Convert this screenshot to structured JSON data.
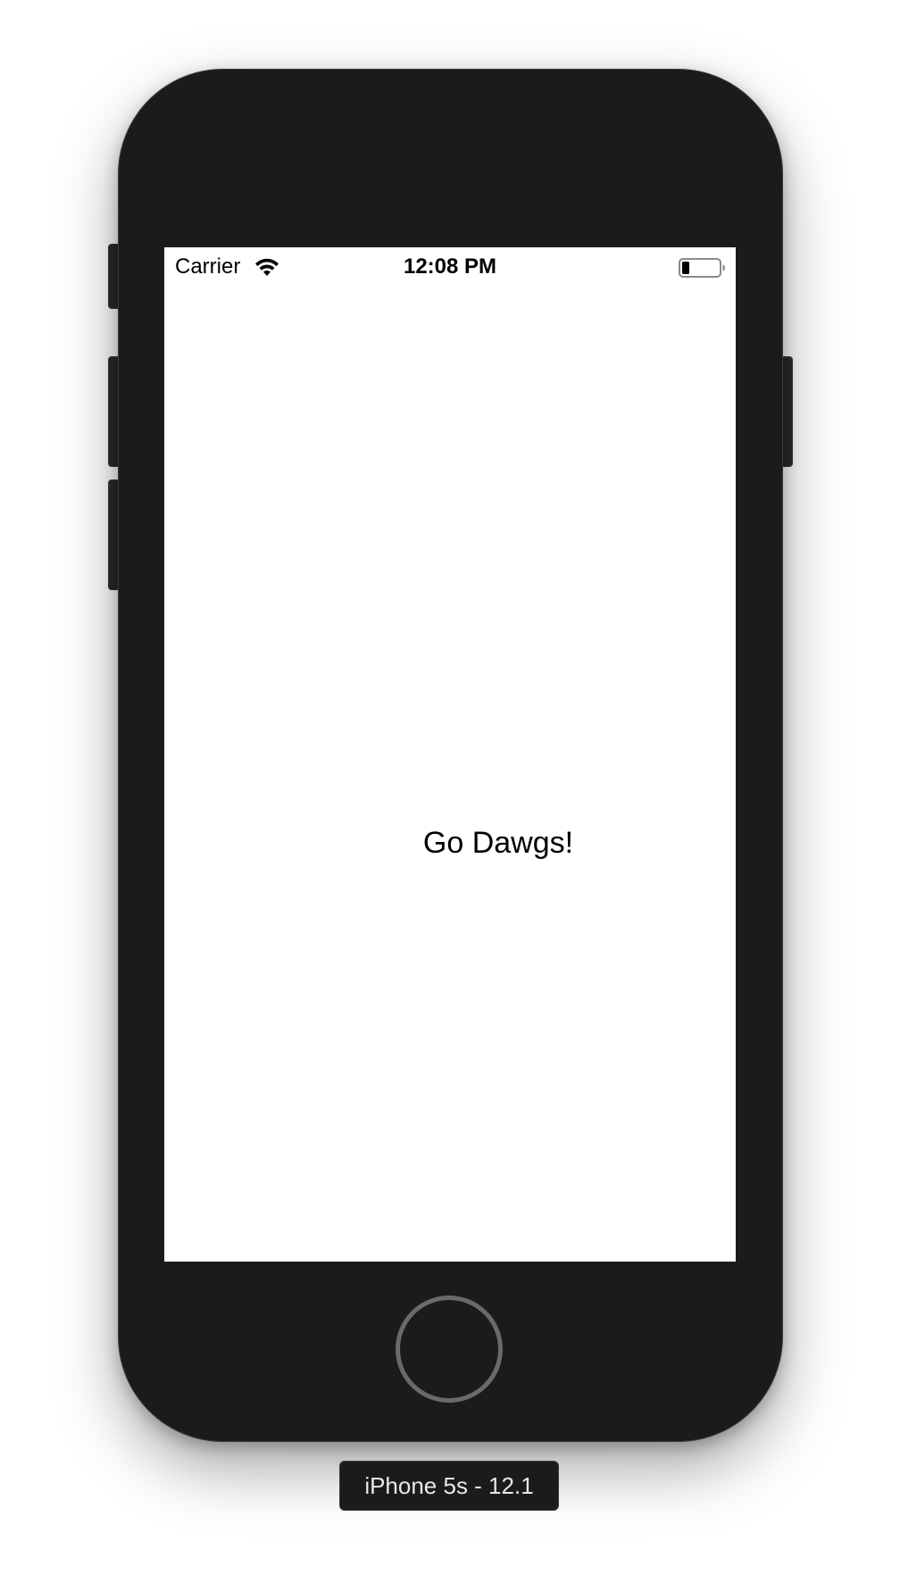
{
  "device": {
    "label": "iPhone 5s - 12.1"
  },
  "status_bar": {
    "carrier": "Carrier",
    "time": "12:08 PM",
    "wifi_icon": "wifi-icon",
    "battery_icon": "battery-icon",
    "battery_level": 0.2
  },
  "screen": {
    "label_text": "Go Dawgs!"
  },
  "colors": {
    "bezel": "#1b1b1b",
    "screen_background": "#ffffff",
    "home_ring": "#6a6a6a"
  }
}
